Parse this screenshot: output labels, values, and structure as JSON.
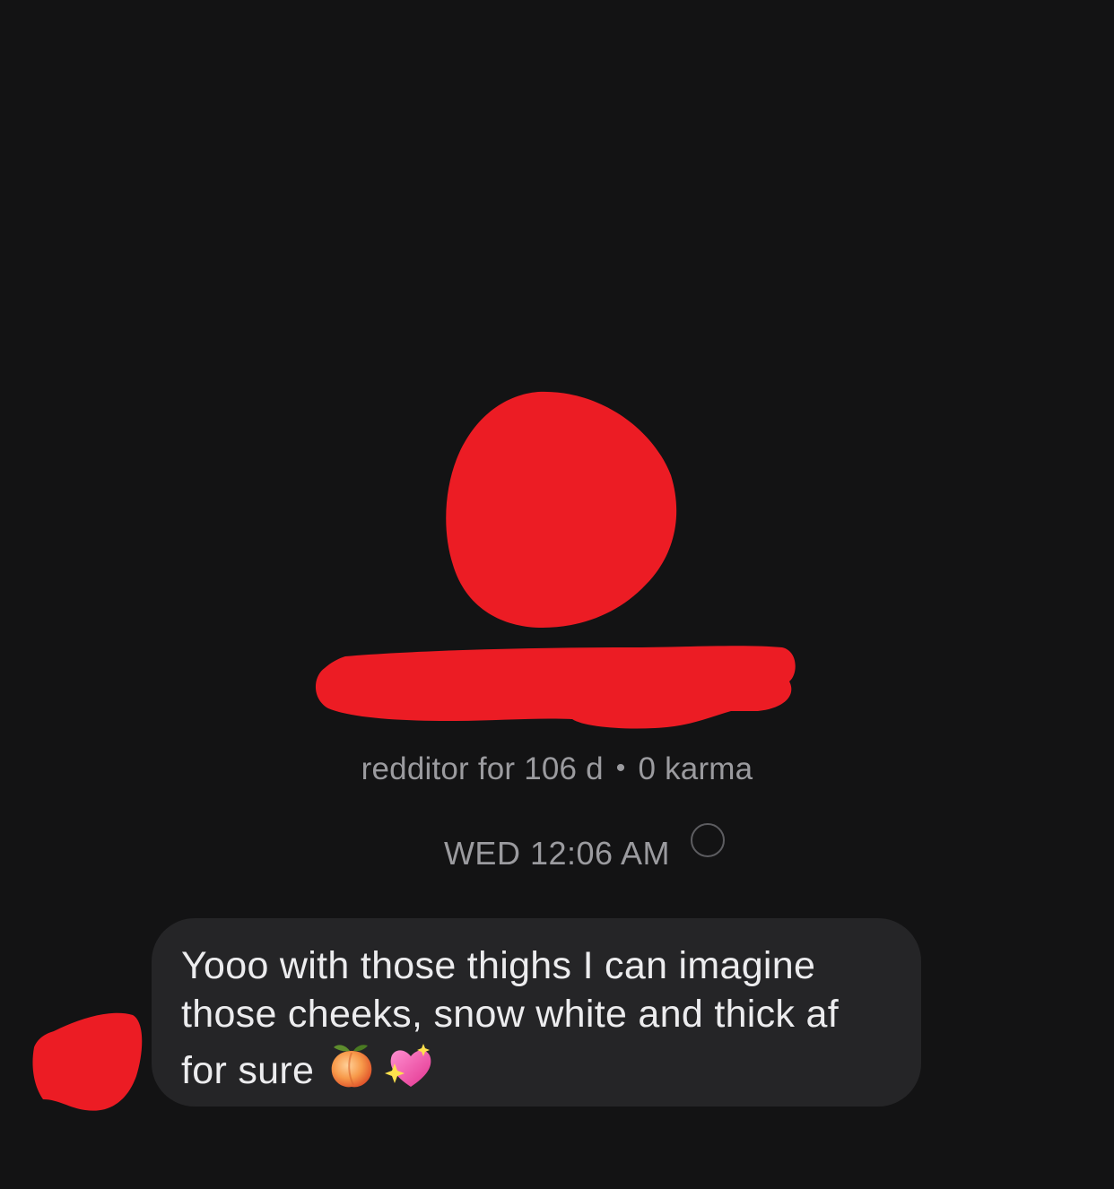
{
  "profile": {
    "account_age": "redditor for 106 d",
    "separator": "•",
    "karma": "0 karma"
  },
  "thread": {
    "timestamp": "WED 12:06 AM"
  },
  "message": {
    "text": "Yooo with those thighs I can imagine\nthose cheeks, snow white and thick af\nfor sure",
    "emojis": [
      "peach-icon",
      "sparkling-heart-icon"
    ]
  },
  "colors": {
    "background": "#131314",
    "bubble": "#252527",
    "muted_text": "#9b9b9f",
    "message_text": "#ececee",
    "redaction": "#ec1c24"
  }
}
